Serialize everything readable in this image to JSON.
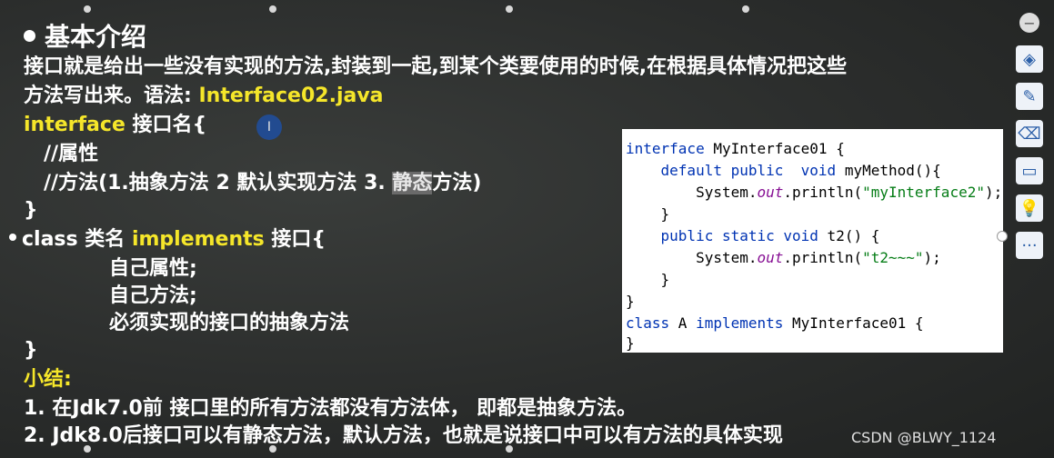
{
  "slide": {
    "title": "基本介绍",
    "intro_line1": "接口就是给出一些没有实现的方法,封装到一起,到某个类要使用的时候,在根据具体情况把这些",
    "intro_line2_prefix": "方法写出来。语法: ",
    "intro_line2_file": "Interface02.java",
    "syntax_interface_kw": "interface",
    "syntax_interface_rest": " 接口名{",
    "comment_props": "//属性",
    "comment_methods_a": "//方法(1.抽象方法 2 默认实现方法 3. ",
    "comment_methods_hl": "静态",
    "comment_methods_b": "方法)",
    "close_brace": "}",
    "class_line_a": "class 类名 ",
    "class_line_kw": "implements",
    "class_line_b": " 接口{",
    "own_props": "自己属性;",
    "own_methods": "自己方法;",
    "must_impl": "必须实现的接口的抽象方法",
    "close_brace2": "}",
    "summary_title": "小结:",
    "summary_1": "1.    在Jdk7.0前 接口里的所有方法都没有方法体， 即都是抽象方法。",
    "summary_2": "2.    Jdk8.0后接口可以有静态方法，默认方法，也就是说接口中可以有方法的具体实现"
  },
  "code": {
    "l1_kw": "interface",
    "l1_rest": " MyInterface01 {",
    "l2_kw": "    default public  void",
    "l2_rest": " myMethod(){",
    "l3_a": "        System.",
    "l3_it": "out",
    "l3_b": ".println(",
    "l3_str": "\"myInterface2\"",
    "l3_c": ");",
    "l4": "    }",
    "l5_kw": "    public static void",
    "l5_rest": " t2() {",
    "l6_a": "        System.",
    "l6_it": "out",
    "l6_b": ".println(",
    "l6_str": "\"t2~~~\"",
    "l6_c": ");",
    "l7": "    }",
    "l8": "}",
    "l9_kw": "class",
    "l9_mid": " A ",
    "l9_kw2": "implements",
    "l9_rest": " MyInterface01 {",
    "l10": "}"
  },
  "toolbar": {
    "close": "−",
    "layers": "◈",
    "pen": "✎",
    "eraser": "⌫",
    "frame": "▭",
    "bulb": "💡",
    "more": "···"
  },
  "cursor": "I",
  "watermark": "CSDN @BLWY_1124"
}
